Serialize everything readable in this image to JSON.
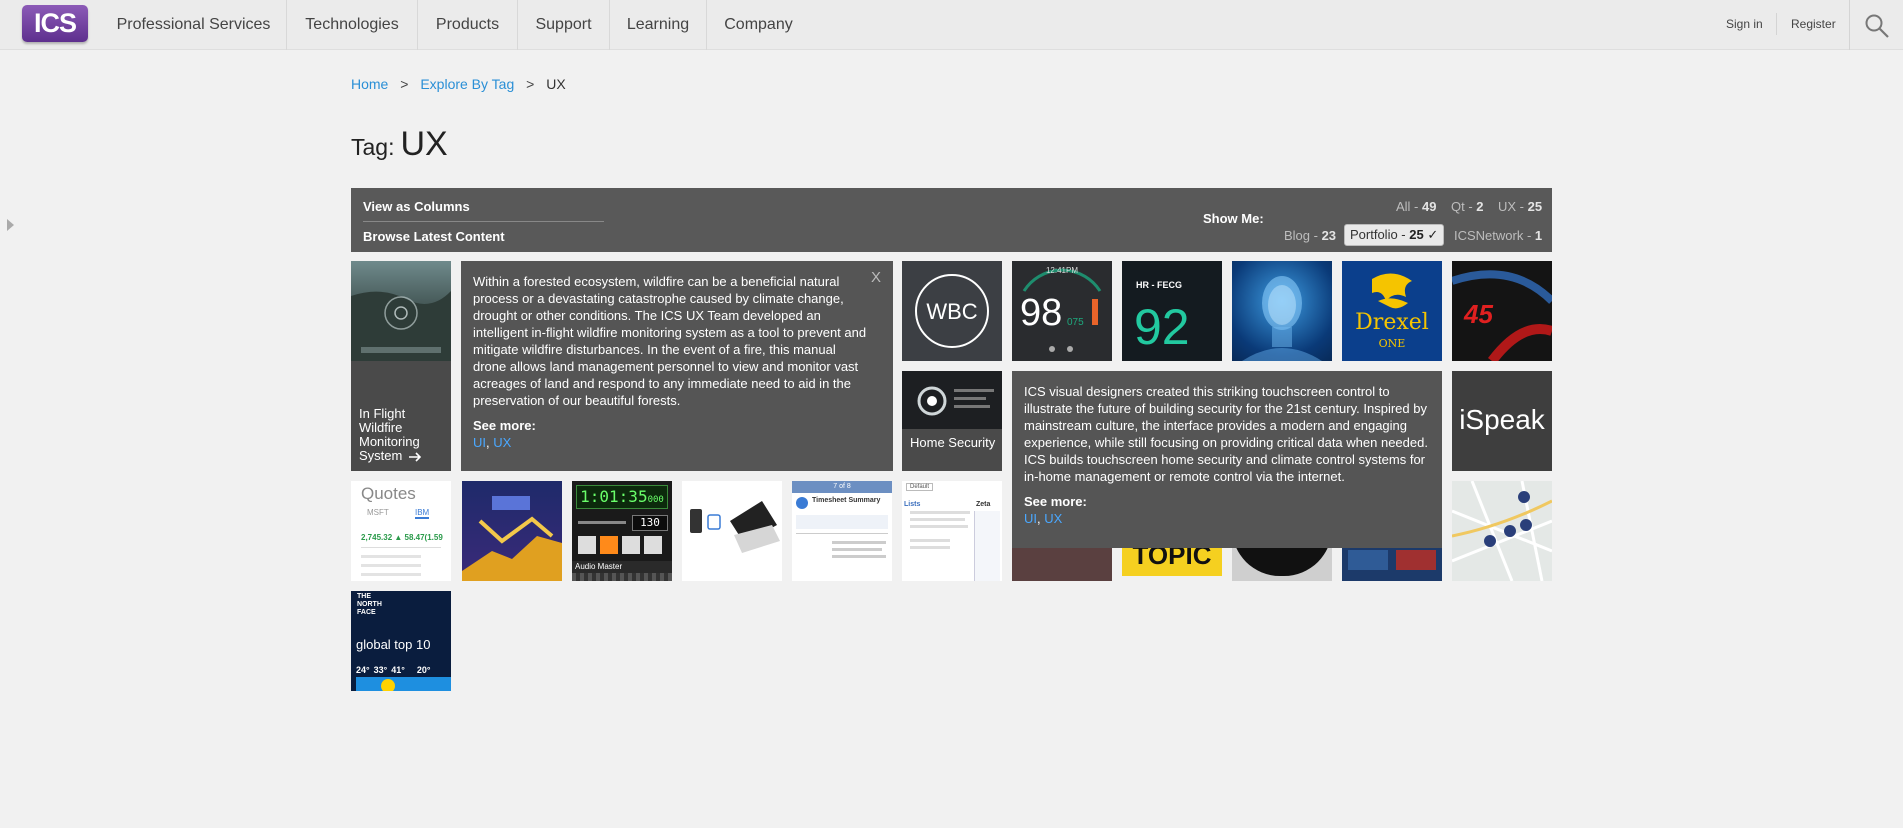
{
  "nav": {
    "logo": "ICS",
    "items": [
      "Professional Services",
      "Technologies",
      "Products",
      "Support",
      "Learning",
      "Company"
    ],
    "signin": "Sign in",
    "register": "Register"
  },
  "breadcrumb": {
    "home": "Home",
    "explore": "Explore By Tag",
    "current": "UX",
    "sep": ">"
  },
  "tag": {
    "label": "Tag:",
    "value": "UX"
  },
  "filterbar": {
    "view_columns": "View as Columns",
    "browse_latest": "Browse Latest Content",
    "show_me": "Show Me:",
    "options_row1": [
      {
        "label": "All - ",
        "count": "49"
      },
      {
        "label": "Qt - ",
        "count": "2"
      },
      {
        "label": "UX - ",
        "count": "25"
      }
    ],
    "options_row2": [
      {
        "label": "Blog - ",
        "count": "23"
      },
      {
        "label": "Portfolio - ",
        "count": "25 ✓"
      },
      {
        "label": "ICSNetwork - ",
        "count": "1"
      }
    ]
  },
  "tiles": {
    "wildfire_caption": "In Flight Wildfire Monitoring System",
    "wbc": "WBC",
    "time": "12:41PM",
    "speed": "98",
    "speed_sub": "075",
    "hr_label": "HR - FECG",
    "hr_value": "92",
    "drexel": "Drexel",
    "drexel_sub": "ONE",
    "mph": "45",
    "security_caption": "Home Security",
    "ispeak": "iSpeak",
    "quotes": "Quotes",
    "quotes_tab1": "MSFT",
    "quotes_tab2": "IBM",
    "quote_price": "2,745.32",
    "quote_change": "▲ 58.47(1.59",
    "clock": "1:01:35",
    "clock_ms": "000",
    "clock_sub": "130",
    "audio": "Audio Master",
    "timesheet_nav": "7 of 8",
    "timesheet_title": "Timesheet Summary",
    "lists_default": "Default",
    "lists_title": "Lists",
    "lists_zeta": "Zeta",
    "topic": "TOPIC",
    "northface": "THE NORTH FACE",
    "global": "global top 10",
    "temps": [
      "24°",
      "33°",
      "41°",
      "20°"
    ]
  },
  "popups": {
    "wildfire": {
      "text": "Within a forested ecosystem, wildfire can be a beneficial natural process or a devastating catastrophe caused by climate change, drought or other conditions. The ICS UX Team developed an intelligent in-flight wildfire monitoring system as a tool to prevent and mitigate wildfire disturbances. In the event of a fire, this manual drone allows land management personnel to view and monitor vast acreages of land and respond to any immediate need to aid in the preservation of our beautiful forests.",
      "see_more": "See more:",
      "tag1": "UI",
      "tag2": "UX",
      "close": "X"
    },
    "security": {
      "text": "ICS visual designers created this striking touchscreen control to illustrate the future of building security for the 21st century. Inspired by mainstream culture, the interface provides a modern and engaging experience, while still focusing on providing critical data when needed. ICS builds touchscreen home security and climate control systems for in-home management or remote control via the internet.",
      "see_more": "See more:",
      "tag1": "UI",
      "tag2": "UX"
    }
  },
  "colors": {
    "accent": "#2a8fd6",
    "logo": "#6b3a9c",
    "bar": "#595959",
    "popup": "#555555"
  }
}
